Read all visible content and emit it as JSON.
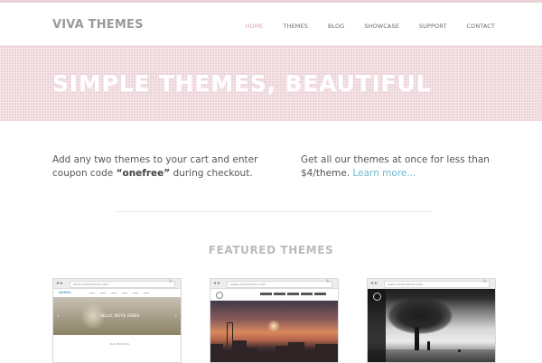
{
  "header": {
    "logo": "VIVA THEMES",
    "nav": [
      "HOME",
      "THEMES",
      "BLOG",
      "SHOWCASE",
      "SUPPORT",
      "CONTACT"
    ],
    "active_item": "HOME"
  },
  "hero": {
    "title": "SIMPLE THEMES, BEAUTIFUL"
  },
  "promos": {
    "left": {
      "text_before": "Add any two themes to your cart and enter coupon code ",
      "code": "“onefree”",
      "text_after": " during checkout."
    },
    "right": {
      "text": "Get all our themes at once for less than $4/theme. ",
      "link": "Learn more..."
    }
  },
  "featured": {
    "title": "FEATURED THEMES",
    "cards": [
      {
        "url": "www.vivathemes.com",
        "logo": "ADEKA",
        "hero_text": "HELLO, WE'RE ADEKA",
        "body_text": "OUR SERVICES"
      },
      {
        "url": "www.vivathemes.com"
      },
      {
        "url": "www.vivathemes.com"
      }
    ]
  },
  "colors": {
    "accent_pink": "#ecd3d8",
    "link_blue": "#6fb8cc",
    "active_nav": "#d9a7ae"
  },
  "icons": {
    "browser_back": "left-arrow-icon",
    "browser_forward": "right-arrow-icon",
    "browser_reload": "reload-icon"
  }
}
